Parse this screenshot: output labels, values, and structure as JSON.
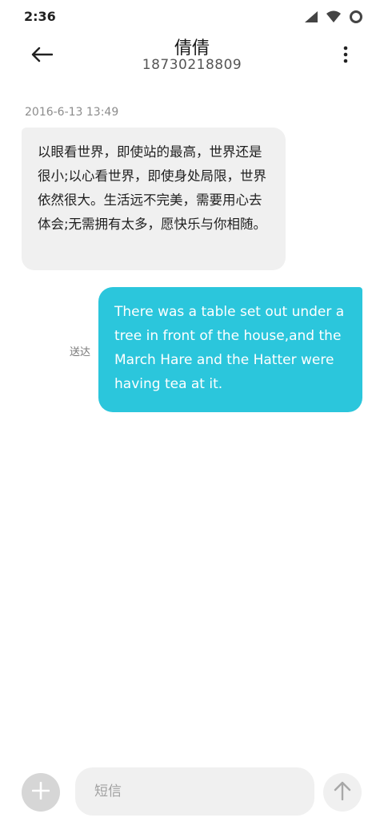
{
  "status_bar": {
    "time": "2:36",
    "icons": [
      "signal-icon",
      "wifi-icon",
      "battery-icon"
    ]
  },
  "header": {
    "back_icon": "arrow-left-icon",
    "contact_name": "倩倩",
    "contact_number": "18730218809",
    "more_icon": "more-vertical-icon"
  },
  "conversation": {
    "timestamp": "2016-6-13 13:49",
    "messages": [
      {
        "direction": "incoming",
        "text": "以眼看世界，即使站的最高，世界还是很小;以心看世界，即使身处局限，世界依然很大。生活远不完美，需要用心去体会;无需拥有太多，愿快乐与你相随。"
      },
      {
        "direction": "outgoing",
        "status": "送达",
        "text": "There was a table set out under a tree in front of the house,and the March Hare and the Hatter were having tea at it."
      }
    ]
  },
  "composer": {
    "add_icon": "plus-icon",
    "placeholder": "短信",
    "value": "",
    "send_icon": "arrow-up-icon"
  },
  "colors": {
    "outgoing_bubble": "#2bc6dc",
    "incoming_bubble": "#f0f0f0",
    "add_button": "#d6d6d6"
  }
}
